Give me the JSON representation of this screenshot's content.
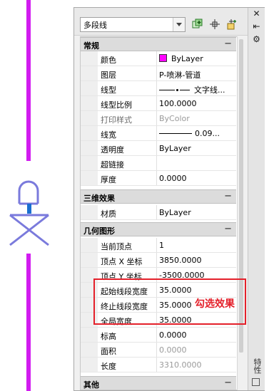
{
  "object_type": "多段线",
  "toolbar": {
    "quick_select_icon": "quick-select-icon",
    "pick_icon": "pick-objects-icon",
    "toggle_pickadd_icon": "pickadd-toggle-icon"
  },
  "side": {
    "close": "✕",
    "autohide": "⇤",
    "settings": "⚙",
    "label": "特性"
  },
  "sections": {
    "general": {
      "title": "常规",
      "toggle": "−",
      "rows": [
        {
          "name": "颜色",
          "value": "ByLayer"
        },
        {
          "name": "图层",
          "value": "P-喷淋-管道"
        },
        {
          "name": "线型",
          "value": "文字线..."
        },
        {
          "name": "线型比例",
          "value": "100.0000"
        },
        {
          "name": "打印样式",
          "value": "ByColor"
        },
        {
          "name": "线宽",
          "value": "0.09..."
        },
        {
          "name": "透明度",
          "value": "ByLayer"
        },
        {
          "name": "超链接",
          "value": ""
        },
        {
          "name": "厚度",
          "value": "0.0000"
        }
      ]
    },
    "three_d": {
      "title": "三维效果",
      "toggle": "−",
      "rows": [
        {
          "name": "材质",
          "value": "ByLayer"
        }
      ]
    },
    "geometry": {
      "title": "几何图形",
      "toggle": "−",
      "rows": [
        {
          "name": "当前顶点",
          "value": "1"
        },
        {
          "name": "顶点 X 坐标",
          "value": "3850.0000"
        },
        {
          "name": "顶点 Y 坐标",
          "value": "-3500.0000"
        },
        {
          "name": "起始线段宽度",
          "value": "35.0000"
        },
        {
          "name": "终止线段宽度",
          "value": "35.0000"
        },
        {
          "name": "全局宽度",
          "value": "35.0000"
        },
        {
          "name": "标高",
          "value": "0.0000"
        },
        {
          "name": "面积",
          "value": "0.0000"
        },
        {
          "name": "长度",
          "value": "3310.0000"
        }
      ]
    },
    "misc": {
      "title": "其他",
      "toggle": "−"
    }
  },
  "annotation": "勾选效果",
  "colors": {
    "polyline": "#d21cf0",
    "color_swatch": "#ff00ff",
    "annotation": "#e4202a"
  }
}
